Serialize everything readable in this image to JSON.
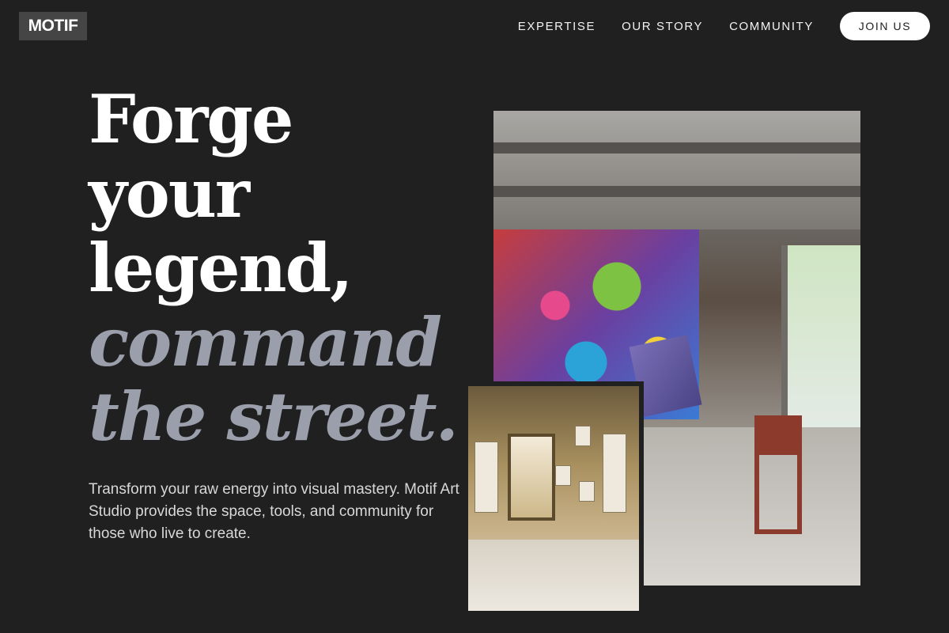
{
  "header": {
    "logo": "MOTIF",
    "nav": [
      {
        "label": "EXPERTISE"
      },
      {
        "label": "OUR STORY"
      },
      {
        "label": "COMMUNITY"
      }
    ],
    "cta": "JOIN US"
  },
  "hero": {
    "lines": [
      "Forge",
      "your",
      "legend,"
    ],
    "accent_lines": [
      "command",
      "the street."
    ],
    "description": "Transform your raw energy into visual mastery. Motif Art Studio provides the space, tools, and community for those who live to create."
  },
  "colors": {
    "background": "#202020",
    "logo_bg": "#454545",
    "accent_text": "#9a9fab",
    "cta_bg": "#ffffff"
  }
}
